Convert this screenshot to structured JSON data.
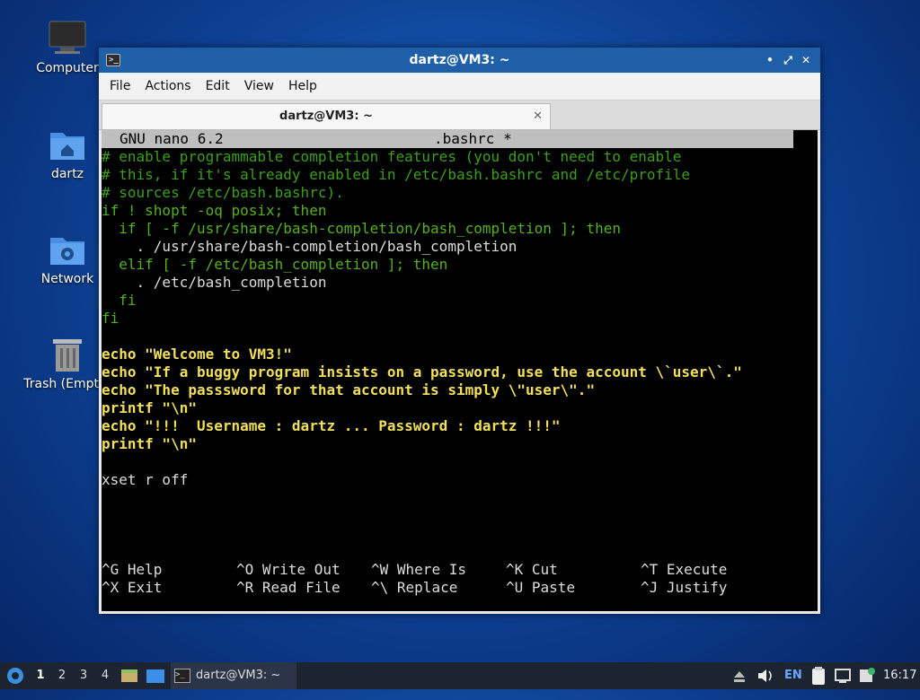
{
  "desktop": {
    "icons": [
      {
        "label": "Computer",
        "icon": "computer-icon"
      },
      {
        "label": "dartz",
        "icon": "home-folder-icon"
      },
      {
        "label": "Network",
        "icon": "network-folder-icon"
      },
      {
        "label": "Trash (Empty)",
        "icon": "trash-icon"
      }
    ]
  },
  "window": {
    "title": "dartz@VM3: ~",
    "menu": [
      "File",
      "Actions",
      "Edit",
      "View",
      "Help"
    ],
    "tab_title": "dartz@VM3: ~",
    "tab_close": "✕"
  },
  "nano": {
    "header_left": "GNU nano 6.2",
    "header_file": ".bashrc *",
    "lines": [
      "# enable programmable completion features (you don't need to enable",
      "# this, if it's already enabled in /etc/bash.bashrc and /etc/profile",
      "# sources /etc/bash.bashrc).",
      "if ! shopt -oq posix; then",
      "  if [ -f /usr/share/bash-completion/bash_completion ]; then",
      "    . /usr/share/bash-completion/bash_completion",
      "  elif [ -f /etc/bash_completion ]; then",
      "    . /etc/bash_completion",
      "  fi",
      "fi",
      "",
      "echo \"Welcome to VM3!\"",
      "echo \"If a buggy program insists on a password, use the account \\`user\\`.\"",
      "echo \"The passsword for that account is simply \\\"user\\\".\"",
      "printf \"\\n\"",
      "echo \"!!!  Username : dartz ... Password : dartz !!!\"",
      "printf \"\\n\"",
      "",
      "xset r off"
    ],
    "shortcuts": [
      {
        "key": "^G",
        "label": "Help"
      },
      {
        "key": "^O",
        "label": "Write Out"
      },
      {
        "key": "^W",
        "label": "Where Is"
      },
      {
        "key": "^K",
        "label": "Cut"
      },
      {
        "key": "^T",
        "label": "Execute"
      },
      {
        "key": "^X",
        "label": "Exit"
      },
      {
        "key": "^R",
        "label": "Read File"
      },
      {
        "key": "^\\",
        "label": "Replace"
      },
      {
        "key": "^U",
        "label": "Paste"
      },
      {
        "key": "^J",
        "label": "Justify"
      }
    ]
  },
  "taskbar": {
    "workspaces": [
      "1",
      "2",
      "3",
      "4"
    ],
    "task_label": "dartz@VM3: ~",
    "lang": "EN",
    "clock": "16:17"
  }
}
